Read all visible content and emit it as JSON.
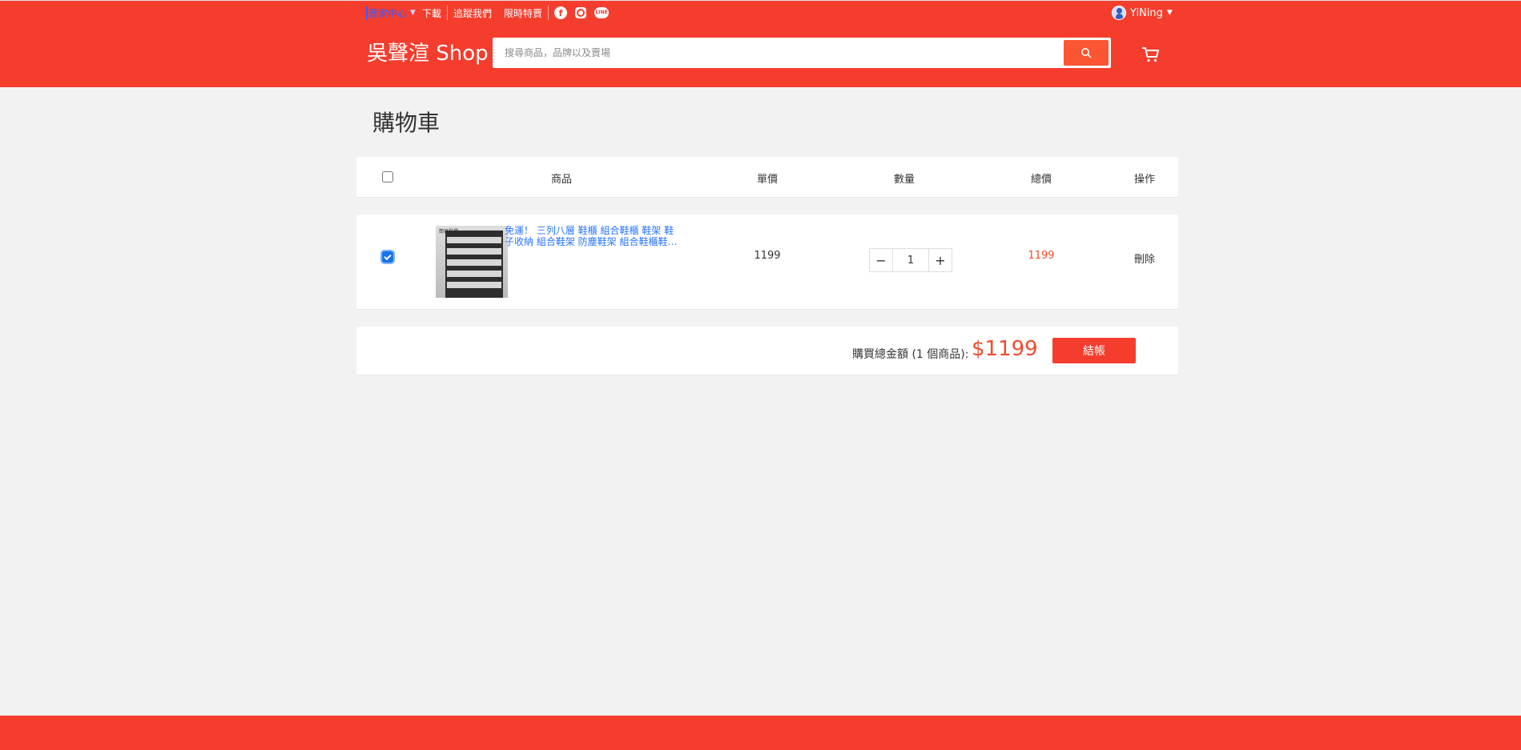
{
  "topbar": {
    "seller_center": "賣家中心",
    "download": "下載",
    "follow_us": "追蹤我們",
    "flash_sale": "限時特賣",
    "social_icons": [
      "facebook-icon",
      "instagram-icon",
      "line-icon"
    ]
  },
  "user": {
    "name": "YiNing"
  },
  "header": {
    "brand": "吳聲渲 Shop",
    "search_placeholder": "搜尋商品，品牌以及賣場"
  },
  "page_title": "購物車",
  "cart_header": {
    "product": "商品",
    "unit_price": "單價",
    "quantity": "數量",
    "total": "總價",
    "action": "操作"
  },
  "cart_items": [
    {
      "selected": true,
      "name": "免運！ 三列八層 鞋櫃 組合鞋櫃 鞋架 鞋子收納 組合鞋架 防塵鞋架 組合鞋櫃鞋…",
      "thumb_tag": "簡易鞋櫃",
      "unit_price": "1199",
      "quantity": "1",
      "total": "1199",
      "action": "刪除"
    }
  ],
  "summary": {
    "label": "購買總金額 (1 個商品):",
    "amount": "$1199",
    "checkout": "結帳"
  },
  "colors": {
    "brand": "#f53d2d",
    "price": "#ee4d2d",
    "link": "#2a75ff"
  }
}
